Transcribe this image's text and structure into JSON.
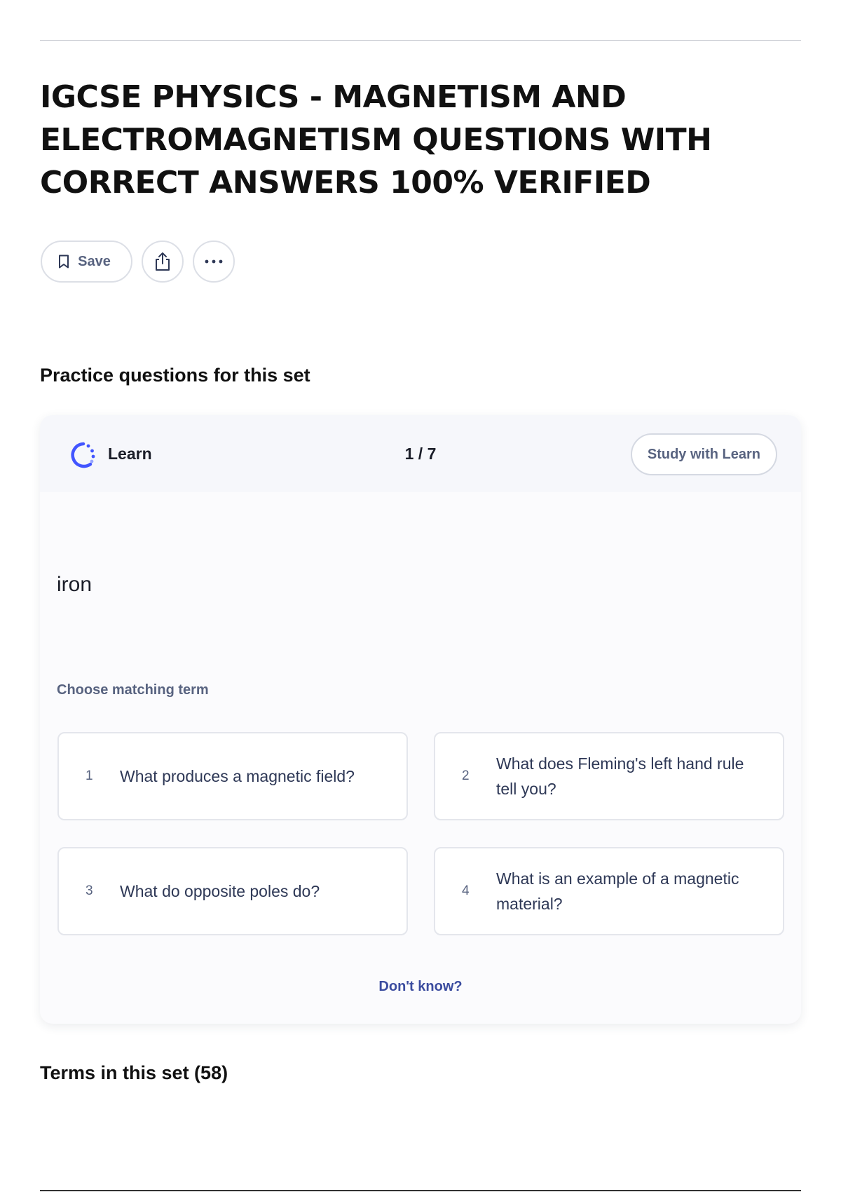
{
  "page": {
    "title": "IGCSE PHYSICS - MAGNETISM AND ELECTROMAGNETISM QUESTIONS WITH CORRECT ANSWERS 100% VERIFIED"
  },
  "actions": {
    "save_label": "Save",
    "share_icon": "share-icon",
    "more_icon": "more-icon"
  },
  "practice": {
    "section_title": "Practice questions for this set",
    "mode_label": "Learn",
    "mode_icon": "learn-icon",
    "progress": "1 / 7",
    "study_button": "Study with Learn",
    "prompt": "iron",
    "instruction": "Choose matching term",
    "options": [
      {
        "number": "1",
        "text": "What produces a magnetic field?"
      },
      {
        "number": "2",
        "text": "What does Fleming's left hand rule tell you?"
      },
      {
        "number": "3",
        "text": "What do opposite poles do?"
      },
      {
        "number": "4",
        "text": "What is an example of a magnetic material?"
      }
    ],
    "dont_know": "Don't know?"
  },
  "terms": {
    "title": "Terms in this set (58)"
  },
  "colors": {
    "accent": "#4255ff",
    "link": "#3b4c9f",
    "muted_text": "#586380"
  }
}
